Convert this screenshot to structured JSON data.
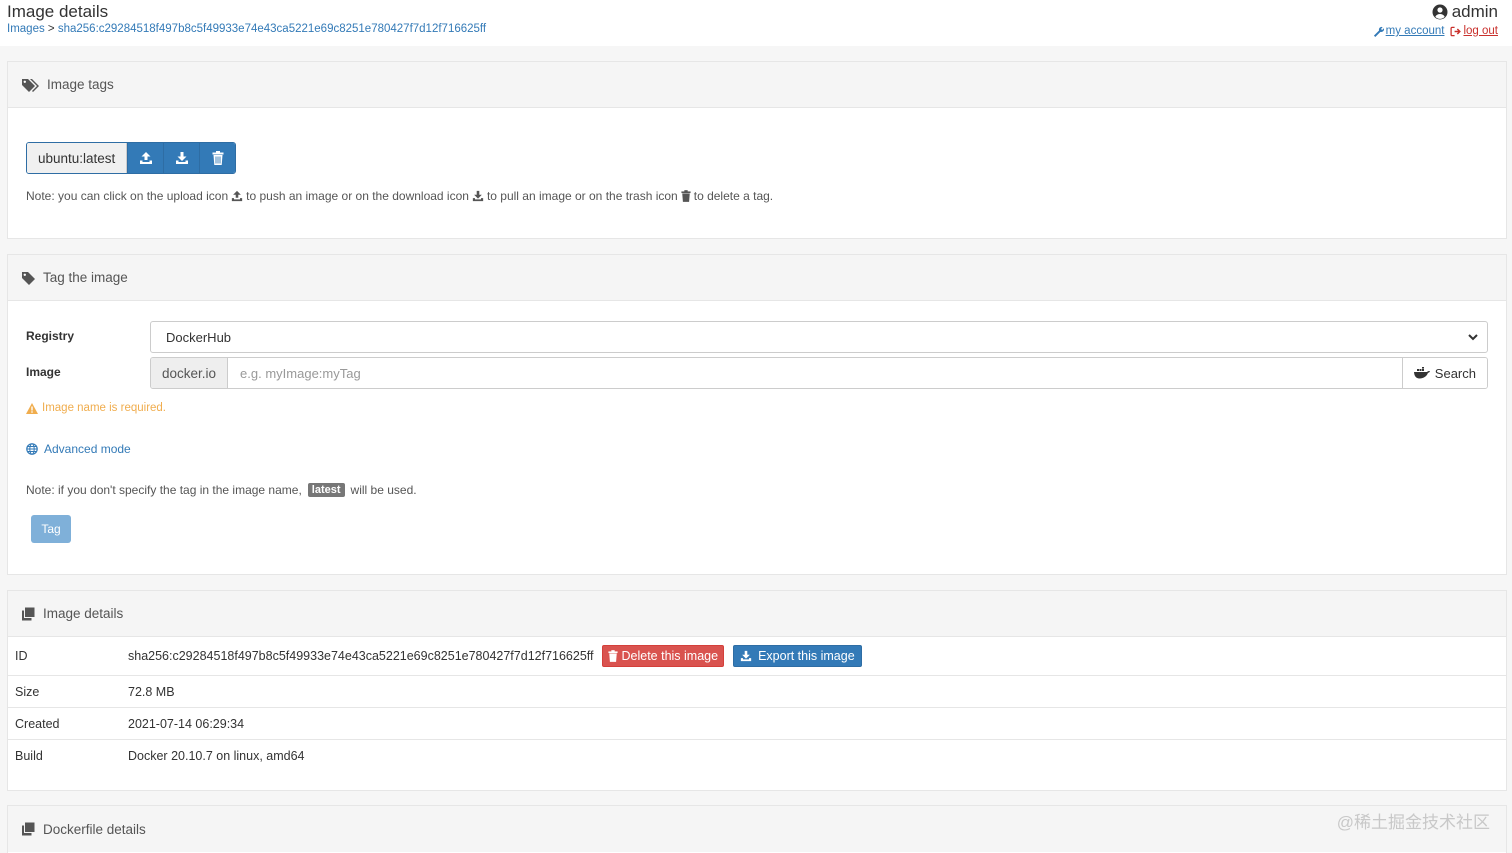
{
  "header": {
    "title": "Image details",
    "breadcrumb_root": "Images",
    "breadcrumb_sep": ">",
    "breadcrumb_current": "sha256:c29284518f497b8c5f49933e74e43ca5221e69c8251e780427f7d12f716625ff",
    "username": "admin",
    "my_account": "my account",
    "log_out": "log out"
  },
  "tags_panel": {
    "title": "Image tags",
    "tag": "ubuntu:latest",
    "note_1": "Note: you can click on the upload icon",
    "note_2": "to push an image or on the download icon",
    "note_3": "to pull an image or on the trash icon",
    "note_4": "to delete a tag."
  },
  "tag_form": {
    "title": "Tag the image",
    "registry_label": "Registry",
    "registry_value": "DockerHub",
    "image_label": "Image",
    "image_prefix": "docker.io",
    "image_placeholder": "e.g. myImage:myTag",
    "search_label": "Search",
    "warning": "Image name is required.",
    "advanced": "Advanced mode",
    "note_before": "Note: if you don't specify the tag in the image name,",
    "note_badge": "latest",
    "note_after": "will be used.",
    "submit": "Tag"
  },
  "details": {
    "title": "Image details",
    "rows": [
      {
        "key": "ID",
        "value": "sha256:c29284518f497b8c5f49933e74e43ca5221e69c8251e780427f7d12f716625ff"
      },
      {
        "key": "Size",
        "value": "72.8 MB"
      },
      {
        "key": "Created",
        "value": "2021-07-14 06:29:34"
      },
      {
        "key": "Build",
        "value": "Docker 20.10.7 on linux, amd64"
      }
    ],
    "delete_label": "Delete this image",
    "export_label": "Export this image"
  },
  "dockerfile": {
    "title": "Dockerfile details"
  },
  "watermark": "@稀土掘金技术社区",
  "colors": {
    "primary": "#337ab7",
    "danger": "#d9534f",
    "warning": "#f0ad4e"
  }
}
